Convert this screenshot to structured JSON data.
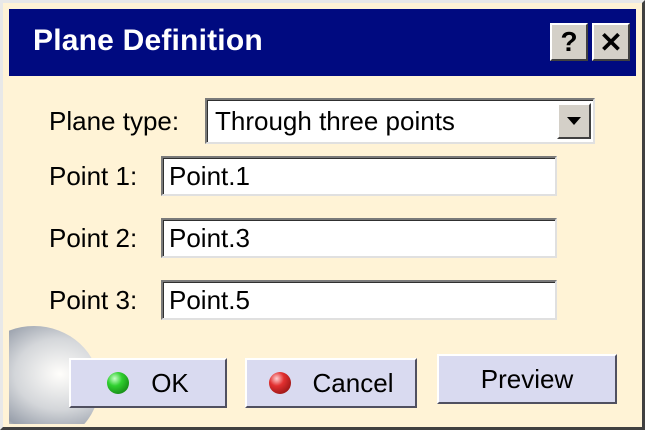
{
  "window": {
    "title": "Plane Definition",
    "help_label": "?",
    "close_label": "✕"
  },
  "form": {
    "plane_type_label": "Plane type:",
    "plane_type_value": "Through three points",
    "point1_label": "Point 1:",
    "point1_value": "Point.1",
    "point2_label": "Point 2:",
    "point2_value": "Point.3",
    "point3_label": "Point 3:",
    "point3_value": "Point.5"
  },
  "buttons": {
    "ok_label": "OK",
    "cancel_label": "Cancel",
    "preview_label": "Preview"
  },
  "colors": {
    "titlebar": "#000a80",
    "dialog_background": "#fff3d6",
    "button_face": "#d9daf0",
    "ok_icon": "#2fd02f",
    "cancel_icon": "#e23030"
  },
  "icons": {
    "help": "help-icon",
    "close": "close-icon",
    "dropdown": "chevron-down-icon",
    "ok": "green-ball-icon",
    "cancel": "red-ball-icon"
  }
}
